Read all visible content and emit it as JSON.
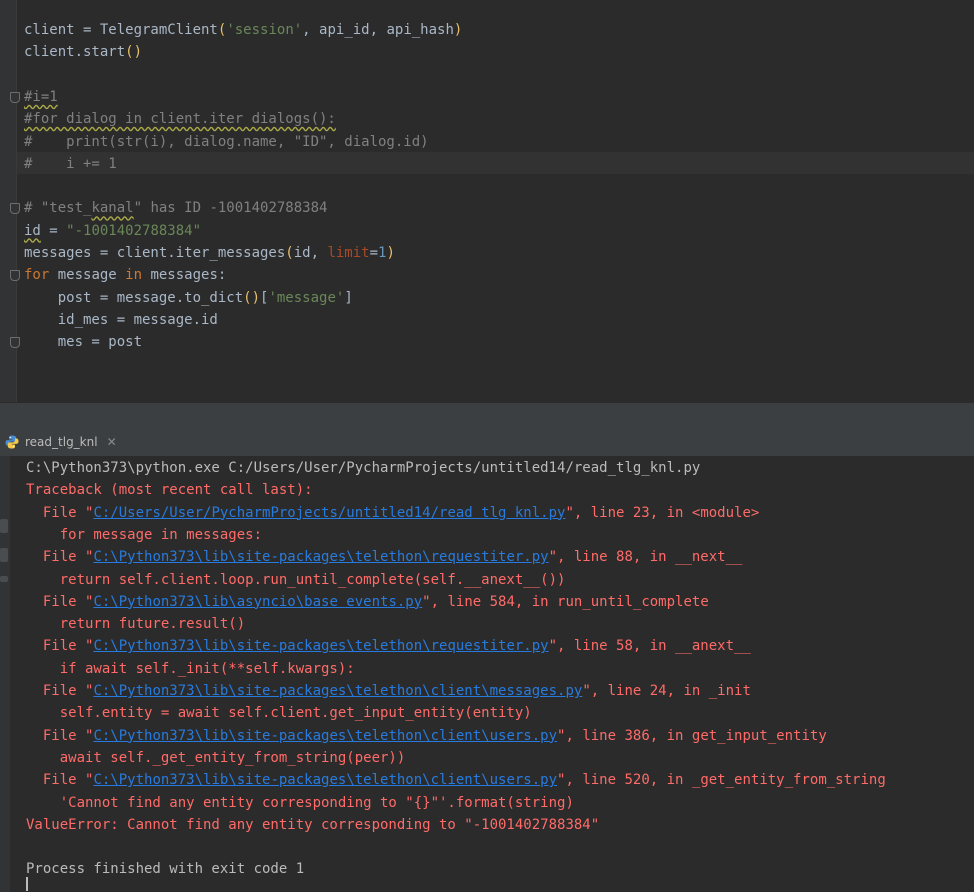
{
  "editor": {
    "lines": [
      {
        "parts": [
          {
            "t": "client = TelegramClient"
          },
          {
            "t": "(",
            "c": "paren"
          },
          {
            "t": "'session'",
            "c": "str"
          },
          {
            "t": ", api_id, api_hash"
          },
          {
            "t": ")",
            "c": "paren"
          }
        ]
      },
      {
        "parts": [
          {
            "t": "client.start"
          },
          {
            "t": "()",
            "c": "paren"
          }
        ]
      },
      {
        "parts": []
      },
      {
        "parts": [
          {
            "t": "#i=1",
            "c": "cmt wavy"
          }
        ],
        "fold": true
      },
      {
        "parts": [
          {
            "t": "#for dialog in client.iter dialogs():",
            "c": "cmt wavy"
          }
        ]
      },
      {
        "parts": [
          {
            "t": "#    print(str(i), dialog.name, \"ID\", dialog.id)",
            "c": "cmt"
          }
        ]
      },
      {
        "parts": [
          {
            "t": "#    i += 1",
            "c": "cmt"
          }
        ],
        "caret": true
      },
      {
        "parts": []
      },
      {
        "parts": [
          {
            "t": "# \"test_",
            "c": "cmt"
          },
          {
            "t": "kanal",
            "c": "cmt wavy"
          },
          {
            "t": "\" has ID -1001402788384",
            "c": "cmt"
          }
        ],
        "fold": true
      },
      {
        "parts": [
          {
            "t": "id",
            "c": "wavy"
          },
          {
            "t": " = "
          },
          {
            "t": "\"-1001402788384\"",
            "c": "str"
          }
        ]
      },
      {
        "parts": [
          {
            "t": "messages = client.iter_messages"
          },
          {
            "t": "(",
            "c": "paren"
          },
          {
            "t": "id, "
          },
          {
            "t": "limit",
            "c": "param"
          },
          {
            "t": "="
          },
          {
            "t": "1",
            "c": "num"
          },
          {
            "t": ")",
            "c": "paren"
          }
        ]
      },
      {
        "parts": [
          {
            "t": "for",
            "c": "kw"
          },
          {
            "t": " message "
          },
          {
            "t": "in",
            "c": "kw"
          },
          {
            "t": " messages:"
          }
        ],
        "fold": true
      },
      {
        "parts": [
          {
            "t": "    post = message.to_dict"
          },
          {
            "t": "()",
            "c": "paren"
          },
          {
            "t": "["
          },
          {
            "t": "'message'",
            "c": "str"
          },
          {
            "t": "]"
          }
        ]
      },
      {
        "parts": [
          {
            "t": "    id_mes = message.id"
          }
        ]
      },
      {
        "parts": [
          {
            "t": "    mes = post"
          }
        ],
        "fold": true
      }
    ]
  },
  "run_tab": {
    "label": "read_tlg_knl"
  },
  "console": {
    "lines": [
      {
        "parts": [
          {
            "t": "C:\\Python373\\python.exe C:/Users/User/PycharmProjects/untitled14/read_tlg_knl.py"
          }
        ]
      },
      {
        "parts": [
          {
            "t": "Traceback (most recent call last):",
            "c": "err"
          }
        ]
      },
      {
        "parts": [
          {
            "t": "  File \"",
            "c": "err"
          },
          {
            "t": "C:/Users/User/PycharmProjects/untitled14/read tlg knl.py",
            "c": "link"
          },
          {
            "t": "\", line 23, in <module>",
            "c": "err"
          }
        ]
      },
      {
        "parts": [
          {
            "t": "    for message in messages:",
            "c": "err"
          }
        ]
      },
      {
        "parts": [
          {
            "t": "  File \"",
            "c": "err"
          },
          {
            "t": "C:\\Python373\\lib\\site-packages\\telethon\\requestiter.py",
            "c": "link"
          },
          {
            "t": "\", line 88, in __next__",
            "c": "err"
          }
        ]
      },
      {
        "parts": [
          {
            "t": "    return self.client.loop.run_until_complete(self.__anext__())",
            "c": "err"
          }
        ]
      },
      {
        "parts": [
          {
            "t": "  File \"",
            "c": "err"
          },
          {
            "t": "C:\\Python373\\lib\\asyncio\\base events.py",
            "c": "link"
          },
          {
            "t": "\", line 584, in run_until_complete",
            "c": "err"
          }
        ]
      },
      {
        "parts": [
          {
            "t": "    return future.result()",
            "c": "err"
          }
        ]
      },
      {
        "parts": [
          {
            "t": "  File \"",
            "c": "err"
          },
          {
            "t": "C:\\Python373\\lib\\site-packages\\telethon\\requestiter.py",
            "c": "link"
          },
          {
            "t": "\", line 58, in __anext__",
            "c": "err"
          }
        ]
      },
      {
        "parts": [
          {
            "t": "    if await self._init(**self.kwargs):",
            "c": "err"
          }
        ]
      },
      {
        "parts": [
          {
            "t": "  File \"",
            "c": "err"
          },
          {
            "t": "C:\\Python373\\lib\\site-packages\\telethon\\client\\messages.py",
            "c": "link"
          },
          {
            "t": "\", line 24, in _init",
            "c": "err"
          }
        ]
      },
      {
        "parts": [
          {
            "t": "    self.entity = await self.client.get_input_entity(entity)",
            "c": "err"
          }
        ]
      },
      {
        "parts": [
          {
            "t": "  File \"",
            "c": "err"
          },
          {
            "t": "C:\\Python373\\lib\\site-packages\\telethon\\client\\users.py",
            "c": "link"
          },
          {
            "t": "\", line 386, in get_input_entity",
            "c": "err"
          }
        ]
      },
      {
        "parts": [
          {
            "t": "    await self._get_entity_from_string(peer))",
            "c": "err"
          }
        ]
      },
      {
        "parts": [
          {
            "t": "  File \"",
            "c": "err"
          },
          {
            "t": "C:\\Python373\\lib\\site-packages\\telethon\\client\\users.py",
            "c": "link"
          },
          {
            "t": "\", line 520, in _get_entity_from_string",
            "c": "err"
          }
        ]
      },
      {
        "parts": [
          {
            "t": "    'Cannot find any entity corresponding to \"{}\"'.format(string)",
            "c": "err"
          }
        ]
      },
      {
        "parts": [
          {
            "t": "ValueError: Cannot find any entity corresponding to \"-1001402788384\"",
            "c": "err"
          }
        ]
      },
      {
        "parts": []
      },
      {
        "parts": [
          {
            "t": "Process finished with exit code 1"
          }
        ]
      }
    ]
  },
  "colors": {
    "background": "#2b2b2b",
    "error_text": "#ff6b68",
    "link": "#287bde",
    "keyword": "#cc7832",
    "string": "#6a8759",
    "comment": "#808080"
  },
  "icons": {
    "run_tab_icon": "python-icon",
    "close_icon": "close-icon"
  }
}
